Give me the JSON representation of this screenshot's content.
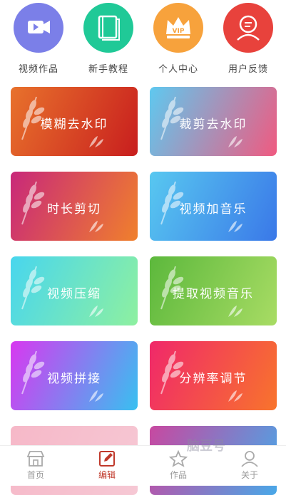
{
  "top_shortcuts": [
    {
      "label": "视频作品",
      "icon": "video-icon",
      "color": "#7b7fe8"
    },
    {
      "label": "新手教程",
      "icon": "book-icon",
      "color": "#20c997"
    },
    {
      "label": "个人中心",
      "icon": "vip-crown-icon",
      "color": "#f7a23c"
    },
    {
      "label": "用户反馈",
      "icon": "feedback-person-icon",
      "color": "#e8423c"
    }
  ],
  "tools": [
    {
      "label": "模糊去水印",
      "gradient": [
        "#e8722c",
        "#c81e1e"
      ]
    },
    {
      "label": "裁剪去水印",
      "gradient": [
        "#5ec9f0",
        "#f05a80"
      ]
    },
    {
      "label": "时长剪切",
      "gradient": [
        "#c8287a",
        "#f0802c"
      ]
    },
    {
      "label": "视频加音乐",
      "gradient": [
        "#58c8f0",
        "#3a78e8"
      ]
    },
    {
      "label": "视频压缩",
      "gradient": [
        "#48d6ee",
        "#8ef0a0"
      ]
    },
    {
      "label": "提取视频音乐",
      "gradient": [
        "#5cb83c",
        "#a8dc64"
      ]
    },
    {
      "label": "视频拼接",
      "gradient": [
        "#d838f0",
        "#38c0f0"
      ]
    },
    {
      "label": "分辨率调节",
      "gradient": [
        "#f0286a",
        "#f8742c"
      ]
    },
    {
      "label": "",
      "gradient": [
        "#f6b8c8",
        "#f6c8d4"
      ]
    },
    {
      "label": "",
      "gradient": [
        "#c848a0",
        "#48a8e8"
      ]
    }
  ],
  "bottom_nav": [
    {
      "label": "首页",
      "icon": "home-shop-icon",
      "active": false
    },
    {
      "label": "编辑",
      "icon": "edit-icon",
      "active": true
    },
    {
      "label": "作品",
      "icon": "works-icon",
      "active": false
    },
    {
      "label": "关于",
      "icon": "person-icon",
      "active": false
    }
  ],
  "watermark": "脑豆号"
}
